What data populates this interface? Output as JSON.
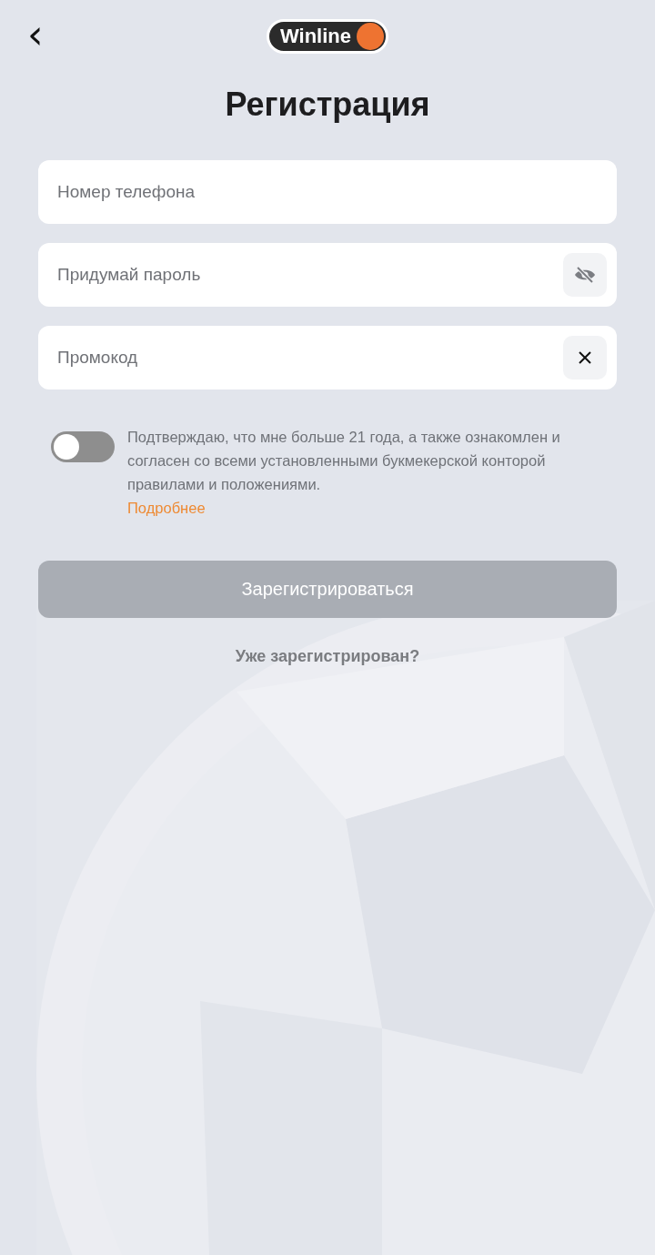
{
  "header": {
    "back": "‹",
    "logo": "Winline"
  },
  "title": "Регистрация",
  "fields": [
    {
      "kind": "plain",
      "placeholder": "Номер телефона"
    },
    {
      "kind": "password",
      "placeholder": "Придумай пароль"
    },
    {
      "kind": "clear",
      "placeholder": "Промокод"
    }
  ],
  "consent": {
    "on": false,
    "text": "Подтверждаю, что мне больше 21 года, а также ознакомлен и согласен со всеми установленными букмекерской конторой правилами и положениями.",
    "link": "Подробнее"
  },
  "submit": {
    "label": "Зарегистрироваться",
    "disabled": true
  },
  "login_link": "Уже зарегистрирован?"
}
